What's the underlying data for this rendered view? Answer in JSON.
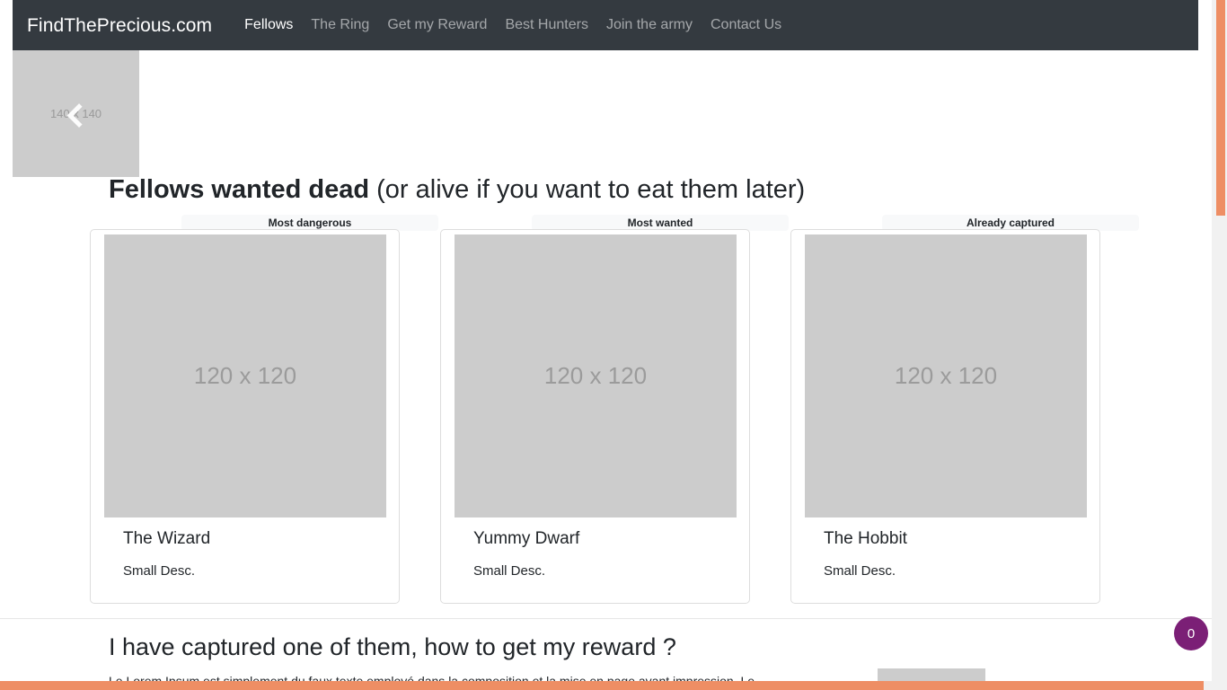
{
  "navbar": {
    "brand": "FindThePrecious.com",
    "links": [
      {
        "label": "Fellows",
        "active": true
      },
      {
        "label": "The Ring",
        "active": false
      },
      {
        "label": "Get my Reward",
        "active": false
      },
      {
        "label": "Best Hunters",
        "active": false
      },
      {
        "label": "Join the army",
        "active": false
      },
      {
        "label": "Contact Us",
        "active": false
      }
    ]
  },
  "hero": {
    "placeholder_label": "140 x 140",
    "prev_control_icon": "chevron-left-icon"
  },
  "main": {
    "title_bold": "Fellows wanted dead",
    "title_rest": " (or alive if you want to eat them later)",
    "cards": [
      {
        "header": "Most dangerous",
        "image_label": "120 x 120",
        "title": "The Wizard",
        "text": "Small Desc."
      },
      {
        "header": "Most wanted",
        "image_label": "120 x 120",
        "title": "Yummy Dwarf",
        "text": "Small Desc."
      },
      {
        "header": "Already captured",
        "image_label": "120 x 120",
        "title": "The Hobbit",
        "text": "Small Desc."
      }
    ]
  },
  "reward_section": {
    "title": "I have captured one of them, how to get my reward ?",
    "paragraph": "Le Lorem Ipsum est simplement du faux texte employé dans la composition et la mise en page avant impression. Le"
  },
  "counter_badge": {
    "value": "0"
  },
  "colors": {
    "navbar_bg": "#343a40",
    "nav_link_muted": "#8d9298",
    "nav_link_active": "#ffffff",
    "placeholder_gray": "#cccccc",
    "card_header_bg": "#f8f9fa",
    "badge_purple": "#7b1f76",
    "scrollbar_orange": "#ee8e64"
  }
}
